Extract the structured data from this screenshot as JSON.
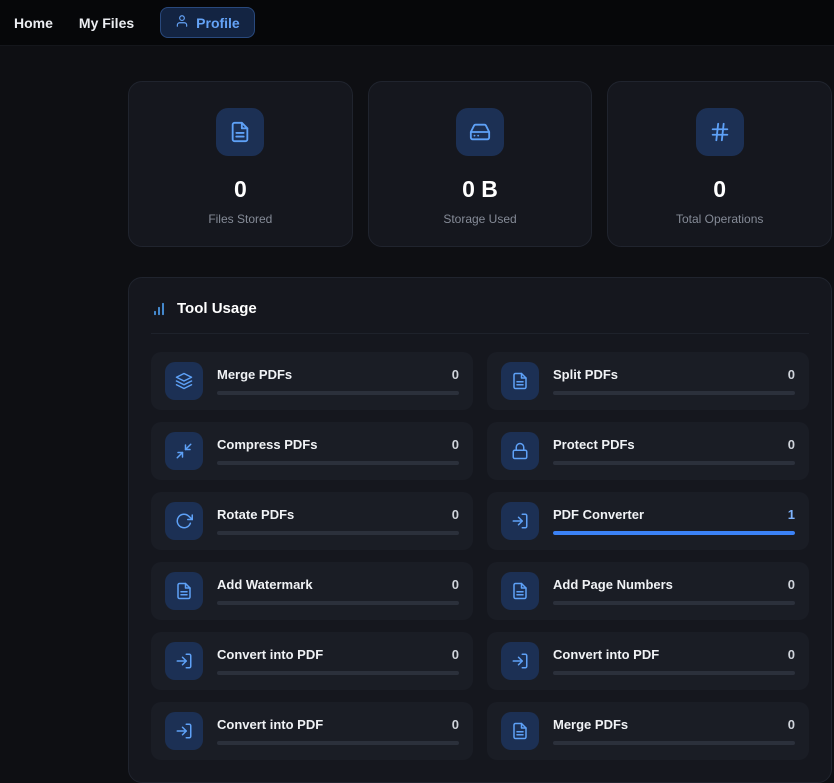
{
  "navbar": {
    "items": [
      {
        "label": "Home",
        "active": false
      },
      {
        "label": "My Files",
        "active": false
      },
      {
        "label": "Profile",
        "active": true,
        "icon": "user-icon"
      }
    ]
  },
  "stats": [
    {
      "icon": "file-text-icon",
      "value": "0",
      "label": "Files Stored"
    },
    {
      "icon": "hard-drive-icon",
      "value": "0 B",
      "label": "Storage Used"
    },
    {
      "icon": "hash-icon",
      "value": "0",
      "label": "Total Operations"
    }
  ],
  "tool_usage": {
    "title": "Tool Usage",
    "header_icon": "bar-chart-icon",
    "items": [
      {
        "icon": "layers-icon",
        "label": "Merge PDFs",
        "count": "0",
        "progress": 0
      },
      {
        "icon": "file-text-icon",
        "label": "Split PDFs",
        "count": "0",
        "progress": 0
      },
      {
        "icon": "minimize-icon",
        "label": "Compress PDFs",
        "count": "0",
        "progress": 0
      },
      {
        "icon": "lock-icon",
        "label": "Protect PDFs",
        "count": "0",
        "progress": 0
      },
      {
        "icon": "rotate-cw-icon",
        "label": "Rotate PDFs",
        "count": "0",
        "progress": 0
      },
      {
        "icon": "import-icon",
        "label": "PDF Converter",
        "count": "1",
        "progress": 100
      },
      {
        "icon": "file-text-icon",
        "label": "Add Watermark",
        "count": "0",
        "progress": 0
      },
      {
        "icon": "file-text-icon",
        "label": "Add Page Numbers",
        "count": "0",
        "progress": 0
      },
      {
        "icon": "import-icon",
        "label": "Convert into PDF",
        "count": "0",
        "progress": 0
      },
      {
        "icon": "import-icon",
        "label": "Convert into PDF",
        "count": "0",
        "progress": 0
      },
      {
        "icon": "import-icon",
        "label": "Convert into PDF",
        "count": "0",
        "progress": 0
      },
      {
        "icon": "file-text-icon",
        "label": "Merge PDFs",
        "count": "0",
        "progress": 0
      }
    ]
  },
  "colors": {
    "accent": "#3b82f6",
    "accent_text": "#7fb3fb",
    "icon_blue": "#5ea1f7"
  }
}
